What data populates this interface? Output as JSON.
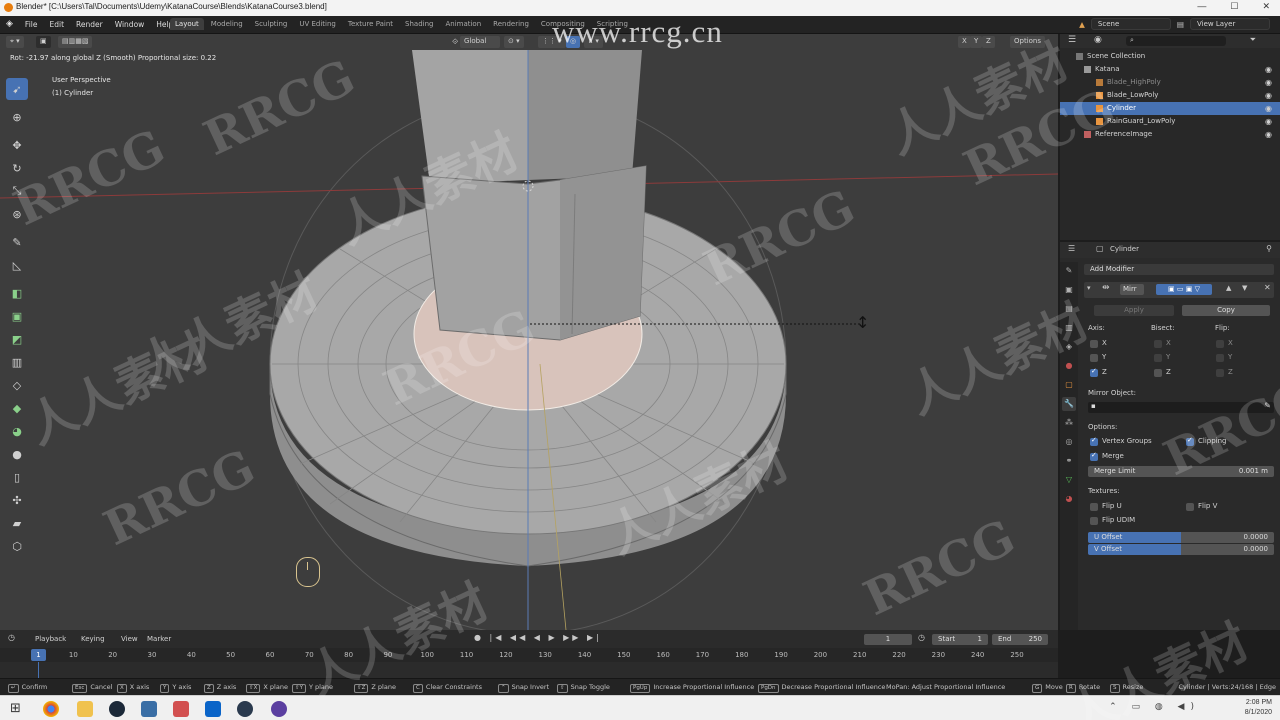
{
  "window": {
    "title": "Blender* [C:\\Users\\Tal\\Documents\\Udemy\\KatanaCourse\\Blends\\KatanaCourse3.blend]",
    "controls": [
      "—",
      "☐",
      "✕"
    ]
  },
  "menu": [
    "File",
    "Edit",
    "Render",
    "Window",
    "Help"
  ],
  "workspace_tabs": [
    "Layout",
    "Modeling",
    "Sculpting",
    "UV Editing",
    "Texture Paint",
    "Shading",
    "Animation",
    "Rendering",
    "Compositing",
    "Scripting"
  ],
  "topbar_right": {
    "scene": "Scene",
    "view_layer": "View Layer"
  },
  "viewport": {
    "header": {
      "transform_orientation": "Global",
      "axes": [
        "X",
        "Y",
        "Z"
      ],
      "options": "Options"
    },
    "operator_info": "Rot: -21.97 along global Z (Smooth) Proportional size: 0.22",
    "perspective": "User Perspective",
    "object_label": "(1) Cylinder"
  },
  "outliner": {
    "root": "Scene Collection",
    "items": [
      {
        "name": "Katana",
        "state": "normal"
      },
      {
        "name": "Blade_HighPoly",
        "state": "dim"
      },
      {
        "name": "Blade_LowPoly",
        "state": "normal"
      },
      {
        "name": "Cylinder",
        "state": "selected"
      },
      {
        "name": "RainGuard_LowPoly",
        "state": "normal"
      },
      {
        "name": "ReferenceImage",
        "state": "normal"
      }
    ]
  },
  "properties": {
    "object_name": "Cylinder",
    "add_modifier": "Add Modifier",
    "modifier_name": "Mirr",
    "apply_label": "Apply",
    "copy_label": "Copy",
    "axis_label": "Axis:",
    "bisect_label": "Bisect:",
    "flip_label": "Flip:",
    "axes": [
      {
        "label": "X",
        "axis": false,
        "bisect": false,
        "flip": false
      },
      {
        "label": "Y",
        "axis": false,
        "bisect": false,
        "flip": false
      },
      {
        "label": "Z",
        "axis": true,
        "bisect": false,
        "flip": false
      }
    ],
    "mirror_object_label": "Mirror Object:",
    "options_label": "Options:",
    "vertex_groups": "Vertex Groups",
    "clipping": "Clipping",
    "merge": "Merge",
    "merge_limit_label": "Merge Limit",
    "merge_limit_value": "0.001 m",
    "textures_label": "Textures:",
    "flip_u": "Flip U",
    "flip_v": "Flip V",
    "flip_udim": "Flip UDIM",
    "u_offset_label": "U Offset",
    "u_offset_value": "0.0000",
    "v_offset_label": "V Offset",
    "v_offset_value": "0.0000"
  },
  "timeline": {
    "menus": [
      "Playback",
      "Keying",
      "View",
      "Marker"
    ],
    "current_frame": "1",
    "start_label": "Start",
    "start_value": "1",
    "end_label": "End",
    "end_value": "250",
    "ruler": [
      "1",
      "10",
      "20",
      "30",
      "40",
      "50",
      "60",
      "70",
      "80",
      "90",
      "100",
      "110",
      "120",
      "130",
      "140",
      "150",
      "160",
      "170",
      "180",
      "190",
      "200",
      "210",
      "220",
      "230",
      "240",
      "250"
    ]
  },
  "statusbar": {
    "hints": [
      {
        "key": "↵",
        "label": "Confirm"
      },
      {
        "key": "Esc",
        "label": "Cancel"
      },
      {
        "key": "X",
        "label": "X axis"
      },
      {
        "key": "Y",
        "label": "Y axis"
      },
      {
        "key": "Z",
        "label": "Z axis"
      },
      {
        "key": "⇧X",
        "label": "X plane"
      },
      {
        "key": "⇧Y",
        "label": "Y plane"
      },
      {
        "key": "⇧Z",
        "label": "Z plane"
      },
      {
        "key": "C",
        "label": "Clear Constraints"
      },
      {
        "key": "⌃",
        "label": "Snap Invert"
      },
      {
        "key": "⇧",
        "label": "Snap Toggle"
      },
      {
        "key": "PgUp",
        "label": "Increase Proportional Influence"
      },
      {
        "key": "PgDn",
        "label": "Decrease Proportional Influence"
      },
      {
        "key": "",
        "label": "MoPan: Adjust Proportional Influence"
      },
      {
        "key": "G",
        "label": "Move"
      },
      {
        "key": "R",
        "label": "Rotate"
      },
      {
        "key": "S",
        "label": "Resize"
      }
    ],
    "stats": "Cylinder | Verts:24/168 | Edge"
  },
  "taskbar": {
    "time": "2:08 PM",
    "date": "8/1/2020"
  },
  "watermark": {
    "url": "www.rrcg.cn",
    "latin": "RRCG",
    "cjk": "人人素材"
  }
}
